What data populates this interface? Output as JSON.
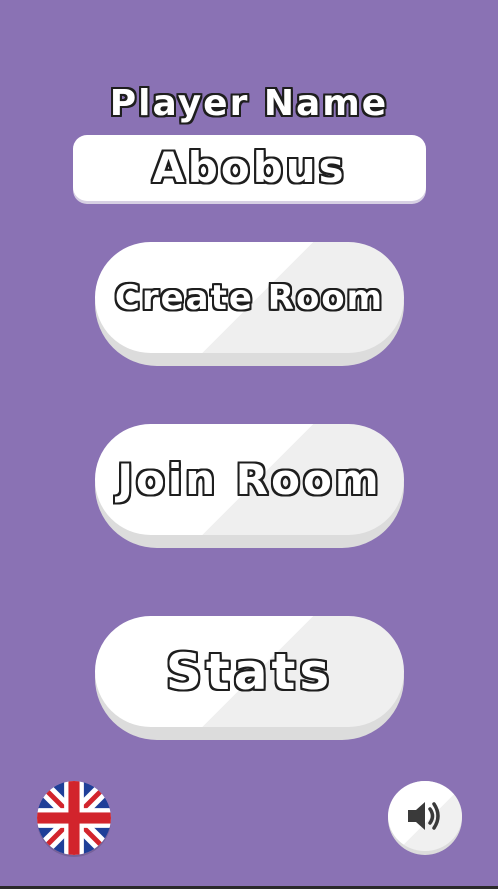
{
  "player": {
    "label": "Player Name",
    "name_value": "Abobus"
  },
  "menu": {
    "create_room_label": "Create Room",
    "join_room_label": "Join Room",
    "stats_label": "Stats"
  },
  "footer": {
    "language_icon": "uk-flag-icon",
    "sound_icon": "speaker-on-icon"
  },
  "colors": {
    "background": "#8a72b4",
    "button_face": "#ffffff",
    "button_shadow": "#dcdcdc",
    "text_outline": "#1e1e1e"
  }
}
